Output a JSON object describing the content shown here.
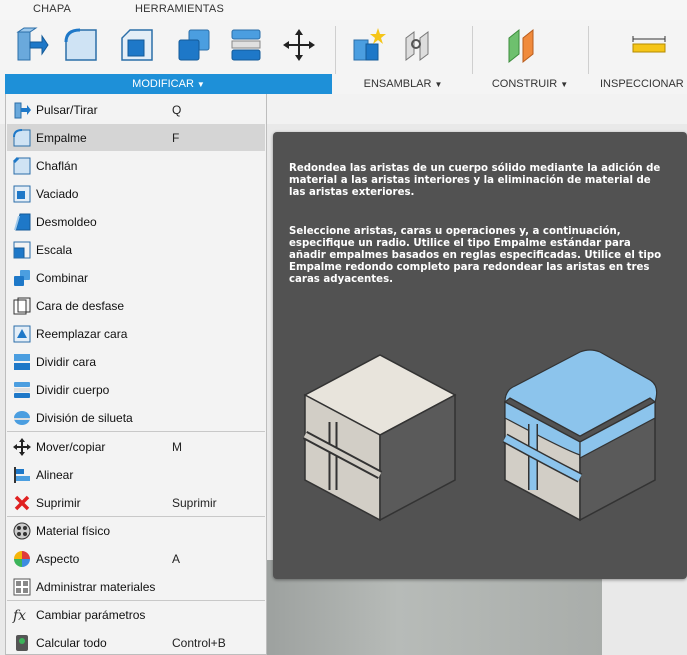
{
  "tabs": [
    "CHAPA",
    "HERRAMIENTAS"
  ],
  "groups": {
    "modificar": "MODIFICAR",
    "ensamblar": "ENSAMBLAR",
    "construir": "CONSTRUIR",
    "inspeccionar": "INSPECCIONAR"
  },
  "toolbar_icons": [
    "press-pull-icon",
    "fillet-icon",
    "chamfer-icon",
    "combine-icon",
    "split-body-icon",
    "move-icon",
    "joint-icon",
    "rigid-group-icon",
    "construct-plane-icon",
    "measure-icon"
  ],
  "colors": {
    "accent": "#1e90d8",
    "menu_bg": "#f3f3f3",
    "tooltip_bg": "#525252",
    "selected_row": "#d5d5d5"
  },
  "menu": {
    "items": [
      {
        "label": "Pulsar/Tirar",
        "key": "Q"
      },
      {
        "label": "Empalme",
        "key": "F"
      },
      {
        "label": "Chaflán",
        "key": ""
      },
      {
        "label": "Vaciado",
        "key": ""
      },
      {
        "label": "Desmoldeo",
        "key": ""
      },
      {
        "label": "Escala",
        "key": ""
      },
      {
        "label": "Combinar",
        "key": ""
      },
      {
        "label": "Cara de desfase",
        "key": ""
      },
      {
        "label": "Reemplazar cara",
        "key": ""
      },
      {
        "label": "Dividir cara",
        "key": ""
      },
      {
        "label": "Dividir cuerpo",
        "key": ""
      },
      {
        "label": "División de silueta",
        "key": ""
      },
      {
        "label": "Mover/copiar",
        "key": "M"
      },
      {
        "label": "Alinear",
        "key": ""
      },
      {
        "label": "Suprimir",
        "key": "Suprimir"
      },
      {
        "label": "Material físico",
        "key": ""
      },
      {
        "label": "Aspecto",
        "key": "A"
      },
      {
        "label": "Administrar materiales",
        "key": ""
      },
      {
        "label": "Cambiar parámetros",
        "key": ""
      },
      {
        "label": "Calcular todo",
        "key": "Control+B"
      }
    ]
  },
  "tooltip": {
    "p1": "Redondea las aristas de un cuerpo sólido mediante la adición de material a las aristas interiores y la eliminación de material de las aristas exteriores.",
    "p2": "Seleccione aristas, caras u operaciones y, a continuación, especifique un radio. Utilice el tipo Empalme estándar para añadir empalmes basados en reglas especificadas. Utilice el tipo Empalme redondo completo para redondear las aristas en tres caras adyacentes."
  }
}
